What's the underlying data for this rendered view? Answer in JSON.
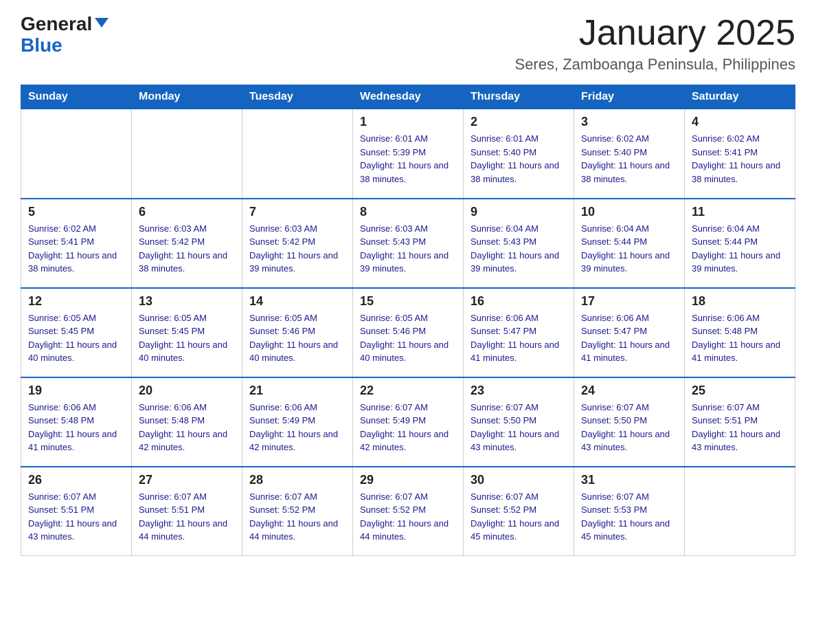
{
  "logo": {
    "general": "General",
    "blue": "Blue",
    "triangle": "▼"
  },
  "title": "January 2025",
  "location": "Seres, Zamboanga Peninsula, Philippines",
  "days_of_week": [
    "Sunday",
    "Monday",
    "Tuesday",
    "Wednesday",
    "Thursday",
    "Friday",
    "Saturday"
  ],
  "weeks": [
    [
      {
        "day": "",
        "info": ""
      },
      {
        "day": "",
        "info": ""
      },
      {
        "day": "",
        "info": ""
      },
      {
        "day": "1",
        "info": "Sunrise: 6:01 AM\nSunset: 5:39 PM\nDaylight: 11 hours and 38 minutes."
      },
      {
        "day": "2",
        "info": "Sunrise: 6:01 AM\nSunset: 5:40 PM\nDaylight: 11 hours and 38 minutes."
      },
      {
        "day": "3",
        "info": "Sunrise: 6:02 AM\nSunset: 5:40 PM\nDaylight: 11 hours and 38 minutes."
      },
      {
        "day": "4",
        "info": "Sunrise: 6:02 AM\nSunset: 5:41 PM\nDaylight: 11 hours and 38 minutes."
      }
    ],
    [
      {
        "day": "5",
        "info": "Sunrise: 6:02 AM\nSunset: 5:41 PM\nDaylight: 11 hours and 38 minutes."
      },
      {
        "day": "6",
        "info": "Sunrise: 6:03 AM\nSunset: 5:42 PM\nDaylight: 11 hours and 38 minutes."
      },
      {
        "day": "7",
        "info": "Sunrise: 6:03 AM\nSunset: 5:42 PM\nDaylight: 11 hours and 39 minutes."
      },
      {
        "day": "8",
        "info": "Sunrise: 6:03 AM\nSunset: 5:43 PM\nDaylight: 11 hours and 39 minutes."
      },
      {
        "day": "9",
        "info": "Sunrise: 6:04 AM\nSunset: 5:43 PM\nDaylight: 11 hours and 39 minutes."
      },
      {
        "day": "10",
        "info": "Sunrise: 6:04 AM\nSunset: 5:44 PM\nDaylight: 11 hours and 39 minutes."
      },
      {
        "day": "11",
        "info": "Sunrise: 6:04 AM\nSunset: 5:44 PM\nDaylight: 11 hours and 39 minutes."
      }
    ],
    [
      {
        "day": "12",
        "info": "Sunrise: 6:05 AM\nSunset: 5:45 PM\nDaylight: 11 hours and 40 minutes."
      },
      {
        "day": "13",
        "info": "Sunrise: 6:05 AM\nSunset: 5:45 PM\nDaylight: 11 hours and 40 minutes."
      },
      {
        "day": "14",
        "info": "Sunrise: 6:05 AM\nSunset: 5:46 PM\nDaylight: 11 hours and 40 minutes."
      },
      {
        "day": "15",
        "info": "Sunrise: 6:05 AM\nSunset: 5:46 PM\nDaylight: 11 hours and 40 minutes."
      },
      {
        "day": "16",
        "info": "Sunrise: 6:06 AM\nSunset: 5:47 PM\nDaylight: 11 hours and 41 minutes."
      },
      {
        "day": "17",
        "info": "Sunrise: 6:06 AM\nSunset: 5:47 PM\nDaylight: 11 hours and 41 minutes."
      },
      {
        "day": "18",
        "info": "Sunrise: 6:06 AM\nSunset: 5:48 PM\nDaylight: 11 hours and 41 minutes."
      }
    ],
    [
      {
        "day": "19",
        "info": "Sunrise: 6:06 AM\nSunset: 5:48 PM\nDaylight: 11 hours and 41 minutes."
      },
      {
        "day": "20",
        "info": "Sunrise: 6:06 AM\nSunset: 5:48 PM\nDaylight: 11 hours and 42 minutes."
      },
      {
        "day": "21",
        "info": "Sunrise: 6:06 AM\nSunset: 5:49 PM\nDaylight: 11 hours and 42 minutes."
      },
      {
        "day": "22",
        "info": "Sunrise: 6:07 AM\nSunset: 5:49 PM\nDaylight: 11 hours and 42 minutes."
      },
      {
        "day": "23",
        "info": "Sunrise: 6:07 AM\nSunset: 5:50 PM\nDaylight: 11 hours and 43 minutes."
      },
      {
        "day": "24",
        "info": "Sunrise: 6:07 AM\nSunset: 5:50 PM\nDaylight: 11 hours and 43 minutes."
      },
      {
        "day": "25",
        "info": "Sunrise: 6:07 AM\nSunset: 5:51 PM\nDaylight: 11 hours and 43 minutes."
      }
    ],
    [
      {
        "day": "26",
        "info": "Sunrise: 6:07 AM\nSunset: 5:51 PM\nDaylight: 11 hours and 43 minutes."
      },
      {
        "day": "27",
        "info": "Sunrise: 6:07 AM\nSunset: 5:51 PM\nDaylight: 11 hours and 44 minutes."
      },
      {
        "day": "28",
        "info": "Sunrise: 6:07 AM\nSunset: 5:52 PM\nDaylight: 11 hours and 44 minutes."
      },
      {
        "day": "29",
        "info": "Sunrise: 6:07 AM\nSunset: 5:52 PM\nDaylight: 11 hours and 44 minutes."
      },
      {
        "day": "30",
        "info": "Sunrise: 6:07 AM\nSunset: 5:52 PM\nDaylight: 11 hours and 45 minutes."
      },
      {
        "day": "31",
        "info": "Sunrise: 6:07 AM\nSunset: 5:53 PM\nDaylight: 11 hours and 45 minutes."
      },
      {
        "day": "",
        "info": ""
      }
    ]
  ]
}
